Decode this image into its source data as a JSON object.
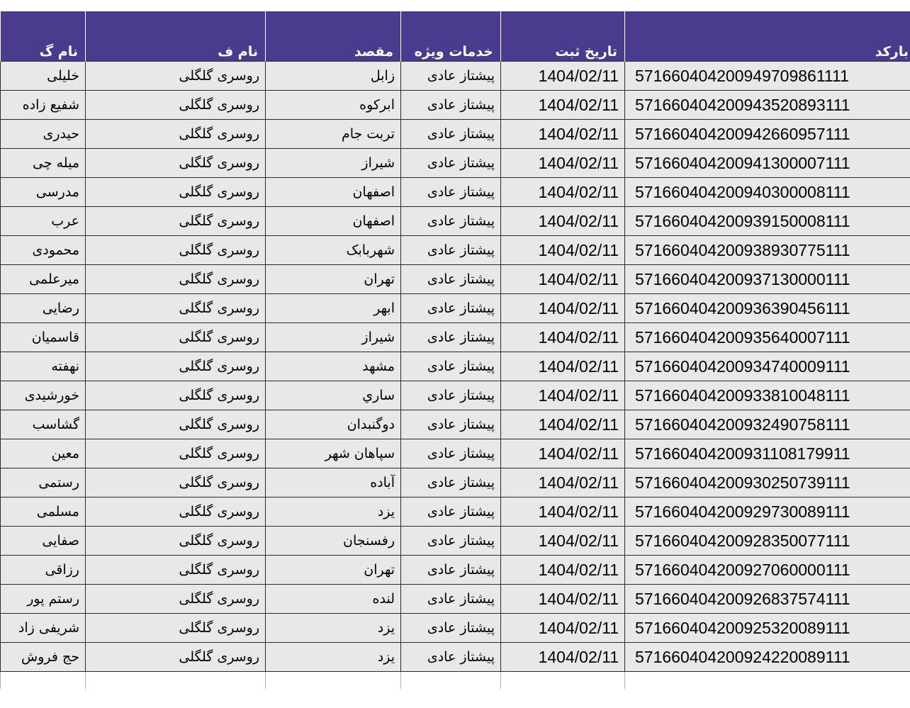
{
  "headers": {
    "last_name": "نام گ",
    "first_name": "نام ف",
    "destination": "مقصد",
    "service": "خدمات ویژه",
    "reg_date": "تاریخ ثبت",
    "barcode": "بارکد"
  },
  "rows": [
    {
      "last_name": "خلیلی",
      "first_name": "روسری گلگلی",
      "destination": "زابل",
      "service": "پیشتاز عادی",
      "reg_date": "1404/02/11",
      "barcode": "571660404200949709861111"
    },
    {
      "last_name": "شفیع زاده",
      "first_name": "روسری گلگلی",
      "destination": "ابرکوه",
      "service": "پیشتاز عادی",
      "reg_date": "1404/02/11",
      "barcode": "571660404200943520893111"
    },
    {
      "last_name": "حیدری",
      "first_name": "روسری گلگلی",
      "destination": "تربت جام",
      "service": "پیشتاز عادی",
      "reg_date": "1404/02/11",
      "barcode": "571660404200942660957111"
    },
    {
      "last_name": "میله چی",
      "first_name": "روسری گلگلی",
      "destination": "شیراز",
      "service": "پیشتاز عادی",
      "reg_date": "1404/02/11",
      "barcode": "571660404200941300007111"
    },
    {
      "last_name": "مدرسی",
      "first_name": "روسری گلگلی",
      "destination": "اصفهان",
      "service": "پیشتاز عادی",
      "reg_date": "1404/02/11",
      "barcode": "571660404200940300008111"
    },
    {
      "last_name": "عرب",
      "first_name": "روسری گلگلی",
      "destination": "اصفهان",
      "service": "پیشتاز عادی",
      "reg_date": "1404/02/11",
      "barcode": "571660404200939150008111"
    },
    {
      "last_name": "محمودی",
      "first_name": "روسری گلگلی",
      "destination": "شهربابک",
      "service": "پیشتاز عادی",
      "reg_date": "1404/02/11",
      "barcode": "571660404200938930775111"
    },
    {
      "last_name": "میرعلمی",
      "first_name": "روسری گلگلی",
      "destination": "تهران",
      "service": "پیشتاز عادی",
      "reg_date": "1404/02/11",
      "barcode": "571660404200937130000111"
    },
    {
      "last_name": "رضایی",
      "first_name": "روسری گلگلی",
      "destination": "ابهر",
      "service": "پیشتاز عادی",
      "reg_date": "1404/02/11",
      "barcode": "571660404200936390456111"
    },
    {
      "last_name": "قاسمیان",
      "first_name": "روسری گلگلی",
      "destination": "شیراز",
      "service": "پیشتاز عادی",
      "reg_date": "1404/02/11",
      "barcode": "571660404200935640007111"
    },
    {
      "last_name": "نهفته",
      "first_name": "روسری گلگلی",
      "destination": "مشهد",
      "service": "پیشتاز عادی",
      "reg_date": "1404/02/11",
      "barcode": "571660404200934740009111"
    },
    {
      "last_name": "خورشیدی",
      "first_name": "روسری گلگلی",
      "destination": "ساري",
      "service": "پیشتاز عادی",
      "reg_date": "1404/02/11",
      "barcode": "571660404200933810048111"
    },
    {
      "last_name": "گشاسب",
      "first_name": "روسری گلگلی",
      "destination": "دوگنبدان",
      "service": "پیشتاز عادی",
      "reg_date": "1404/02/11",
      "barcode": "571660404200932490758111"
    },
    {
      "last_name": "معین",
      "first_name": "روسری گلگلی",
      "destination": "سپاهان شهر",
      "service": "پیشتاز عادی",
      "reg_date": "1404/02/11",
      "barcode": "571660404200931108179911"
    },
    {
      "last_name": "رستمی",
      "first_name": "روسری گلگلی",
      "destination": "آباده",
      "service": "پیشتاز عادی",
      "reg_date": "1404/02/11",
      "barcode": "571660404200930250739111"
    },
    {
      "last_name": "مسلمی",
      "first_name": "روسری گلگلی",
      "destination": "یزد",
      "service": "پیشتاز عادی",
      "reg_date": "1404/02/11",
      "barcode": "571660404200929730089111"
    },
    {
      "last_name": "صفایی",
      "first_name": "روسری گلگلی",
      "destination": "رفسنجان",
      "service": "پیشتاز عادی",
      "reg_date": "1404/02/11",
      "barcode": "571660404200928350077111"
    },
    {
      "last_name": "رزاقی",
      "first_name": "روسری گلگلی",
      "destination": "تهران",
      "service": "پیشتاز عادی",
      "reg_date": "1404/02/11",
      "barcode": "571660404200927060000111"
    },
    {
      "last_name": "رستم پور",
      "first_name": "روسری گلگلی",
      "destination": "لنده",
      "service": "پیشتاز عادی",
      "reg_date": "1404/02/11",
      "barcode": "571660404200926837574111"
    },
    {
      "last_name": "شریفی زاد",
      "first_name": "روسری گلگلی",
      "destination": "یزد",
      "service": "پیشتاز عادی",
      "reg_date": "1404/02/11",
      "barcode": "571660404200925320089111"
    },
    {
      "last_name": "حج فروش",
      "first_name": "روسری گلگلی",
      "destination": "یزد",
      "service": "پیشتاز عادی",
      "reg_date": "1404/02/11",
      "barcode": "571660404200924220089111"
    }
  ],
  "colors": {
    "header_bg": "#4b3b8f",
    "header_text": "#ffffff",
    "cell_bg": "#e8e8e8",
    "grid": "#2b2b2b"
  }
}
